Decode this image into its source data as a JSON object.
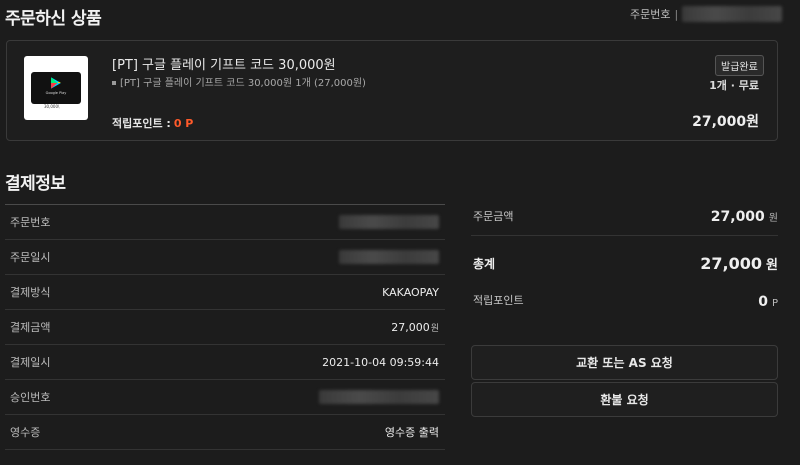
{
  "ordered_section": {
    "title": "주문하신 상품",
    "order_no_label": "주문번호",
    "order_no_separator": "|"
  },
  "product": {
    "thumb_brand": "Google Play",
    "thumb_amount": "30,000\\",
    "name": "[PT] 구글 플레이 기프트 코드 30,000원",
    "sub": "[PT] 구글 플레이 기프트 코드 30,000원 1개 (27,000원)",
    "badge": "발급완료",
    "qty_ship": "1개 · 무료",
    "points_label": "적립포인트 :",
    "points_value": "0 P",
    "price": "27,000원"
  },
  "payment": {
    "title": "결제정보",
    "rows": [
      {
        "label": "주문번호",
        "value": ""
      },
      {
        "label": "주문일시",
        "value": ""
      },
      {
        "label": "결제방식",
        "value": "KAKAOPAY"
      },
      {
        "label": "결제금액",
        "value": "27,000",
        "unit": "원"
      },
      {
        "label": "결제일시",
        "value": "2021-10-04 09:59:44"
      },
      {
        "label": "승인번호",
        "value": ""
      },
      {
        "label": "영수증",
        "value": "영수증 출력"
      }
    ]
  },
  "summary": {
    "order_amount_label": "주문금액",
    "order_amount_value": "27,000",
    "order_amount_unit": "원",
    "total_label": "총계",
    "total_value": "27,000",
    "total_unit": "원",
    "points_label": "적립포인트",
    "points_value": "0",
    "points_unit": "P"
  },
  "buttons": {
    "exchange": "교환 또는 AS 요청",
    "refund": "환불 요청"
  },
  "colors": {
    "background": "#1c1c1c",
    "points_accent": "#ff5a2a"
  }
}
